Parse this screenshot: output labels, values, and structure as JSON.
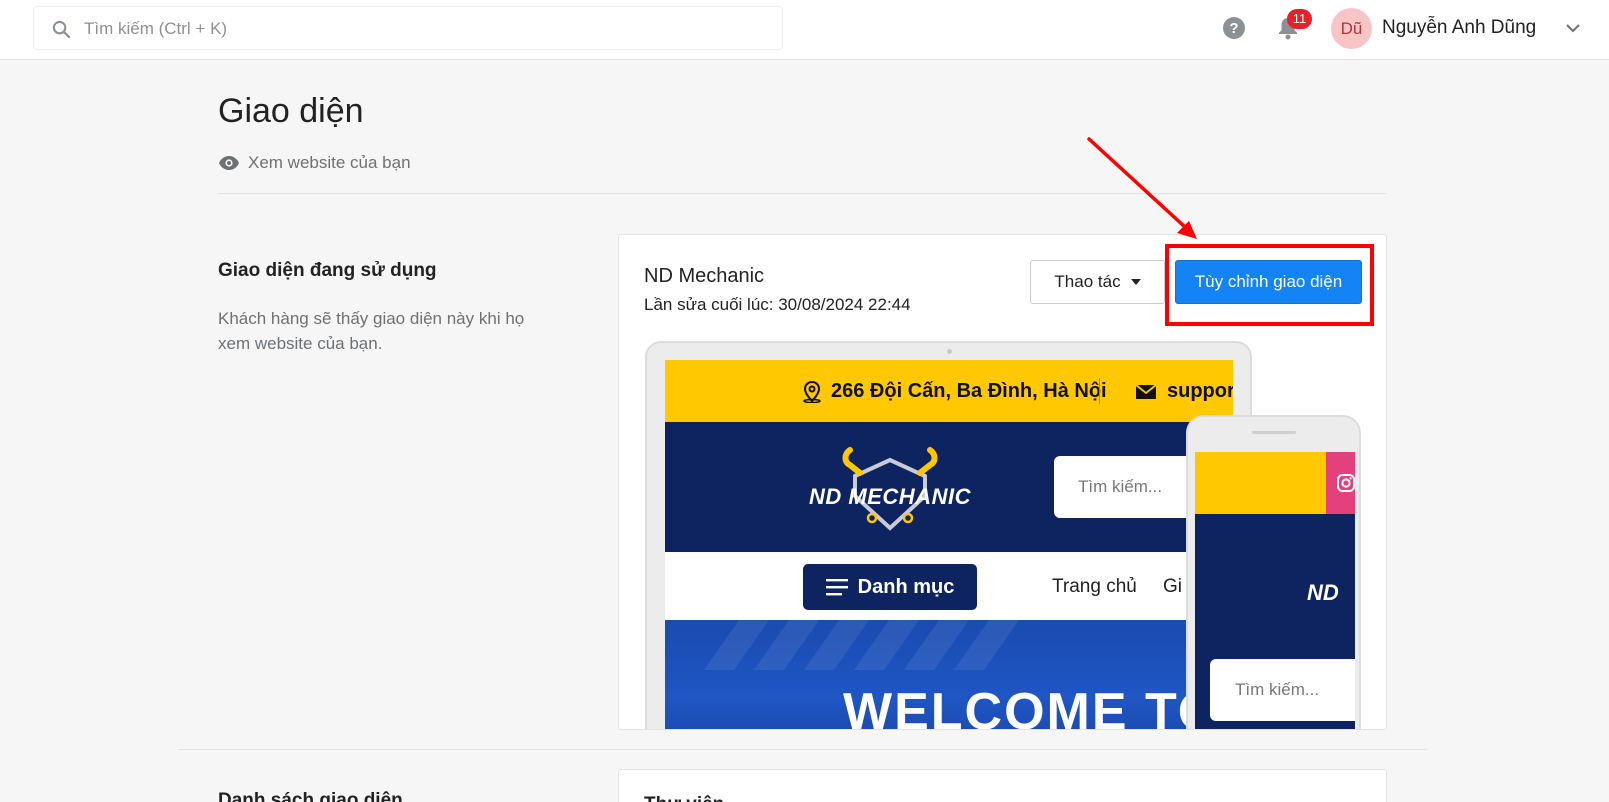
{
  "topbar": {
    "search_placeholder": "Tìm kiếm (Ctrl + K)",
    "notification_count": "11",
    "avatar_initials": "Dũ",
    "user_name": "Nguyễn Anh Dũng"
  },
  "page": {
    "title": "Giao diện",
    "view_site_label": "Xem website của bạn"
  },
  "current_theme_section": {
    "title": "Giao diện đang sử dụng",
    "description": "Khách hàng sẽ thấy giao diện này khi họ xem website của bạn."
  },
  "theme_card": {
    "name": "ND Mechanic",
    "last_edited": "Lần sửa cuối lúc: 30/08/2024 22:44",
    "actions_label": "Thao tác",
    "customize_label": "Tùy chỉnh giao diện"
  },
  "preview": {
    "address": "266 Đội Cấn, Ba Đình, Hà Nội",
    "email_partial": "suppor",
    "logo_text": "ND MECHANIC",
    "search_placeholder": "Tìm kiếm...",
    "category_button": "Danh mục",
    "nav_home": "Trang chủ",
    "nav_partial": "Gi",
    "hero_text": "WELCOME TO",
    "mobile_logo_partial": "ND",
    "mobile_search_placeholder": "Tìm kiếm..."
  },
  "library_section": {
    "title": "Danh sách giao diện",
    "card_title": "Thư viện"
  },
  "colors": {
    "accent_blue": "#1383f5",
    "highlight_red": "#ff0000",
    "preview_yellow": "#ffc800",
    "preview_navy": "#0e2460"
  }
}
